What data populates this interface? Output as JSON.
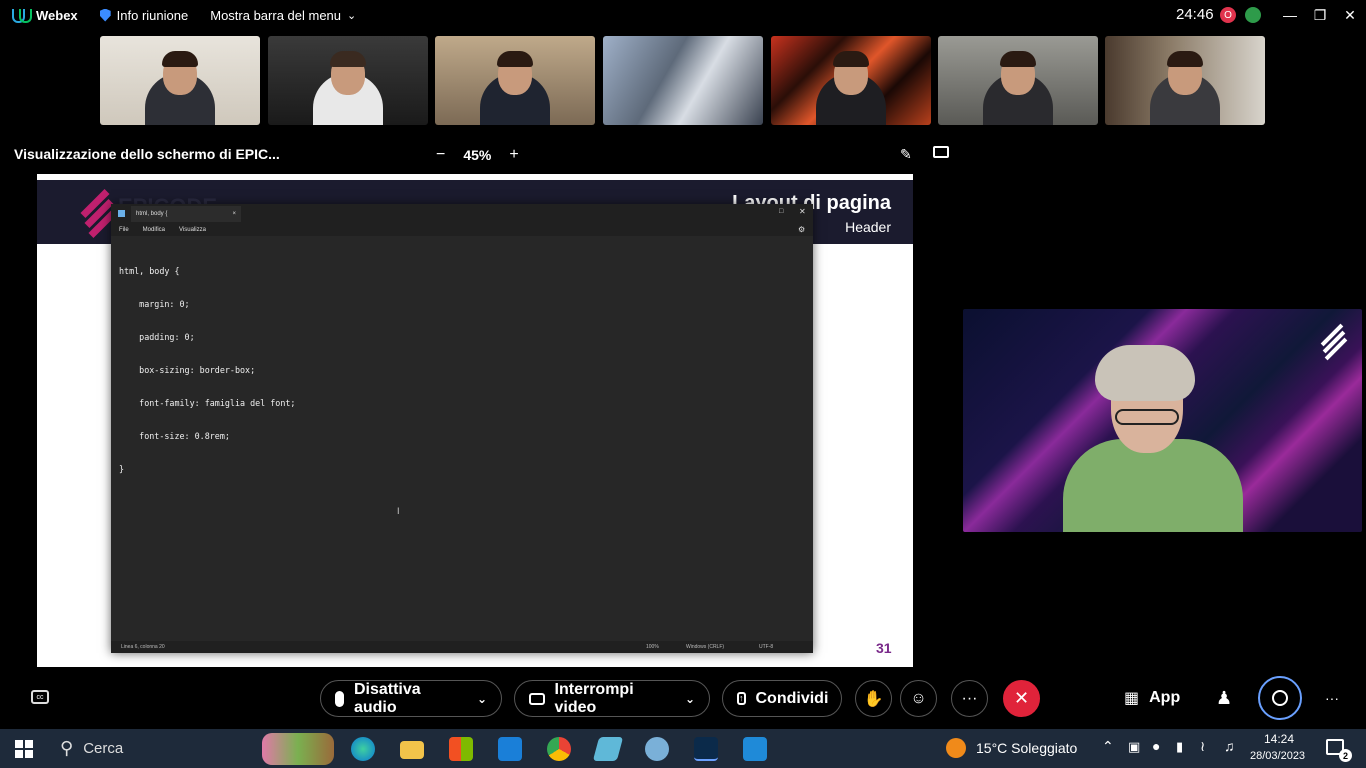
{
  "topbar": {
    "app_name": "Webex",
    "meeting_info": "Info riunione",
    "menu_toggle": "Mostra barra del menu",
    "timer": "24:46",
    "record_badge": "O"
  },
  "share": {
    "title": "Visualizzazione dello schermo di EPIC...",
    "zoom_minus": "−",
    "zoom_level": "45%",
    "zoom_plus": "+"
  },
  "slide": {
    "brand": "EPICODE",
    "title": "Layout di pagina",
    "subtitle": "Header",
    "page_number": "31"
  },
  "notepad": {
    "tab_title": "html, body {",
    "tab_close": "×",
    "menu": [
      "File",
      "Modifica",
      "Visualizza"
    ],
    "code_lines": [
      "html, body {",
      "    margin: 0;",
      "    padding: 0;",
      "    box-sizing: border-box;",
      "    font-family: famiglia del font;",
      "    font-size: 0.8rem;",
      "}"
    ],
    "status": {
      "position": "Linea 6, colonna 20",
      "zoom": "100%",
      "line_ending": "Windows (CRLF)",
      "encoding": "UTF-8"
    }
  },
  "controls": {
    "mute_label": "Disattiva audio",
    "video_label": "Interrompi video",
    "share_label": "Condividi",
    "apps_label": "App",
    "more": "···"
  },
  "taskbar": {
    "search_placeholder": "Cerca",
    "weather": "15°C  Soleggiato",
    "time": "14:24",
    "date": "28/03/2023",
    "notifications": "2"
  }
}
